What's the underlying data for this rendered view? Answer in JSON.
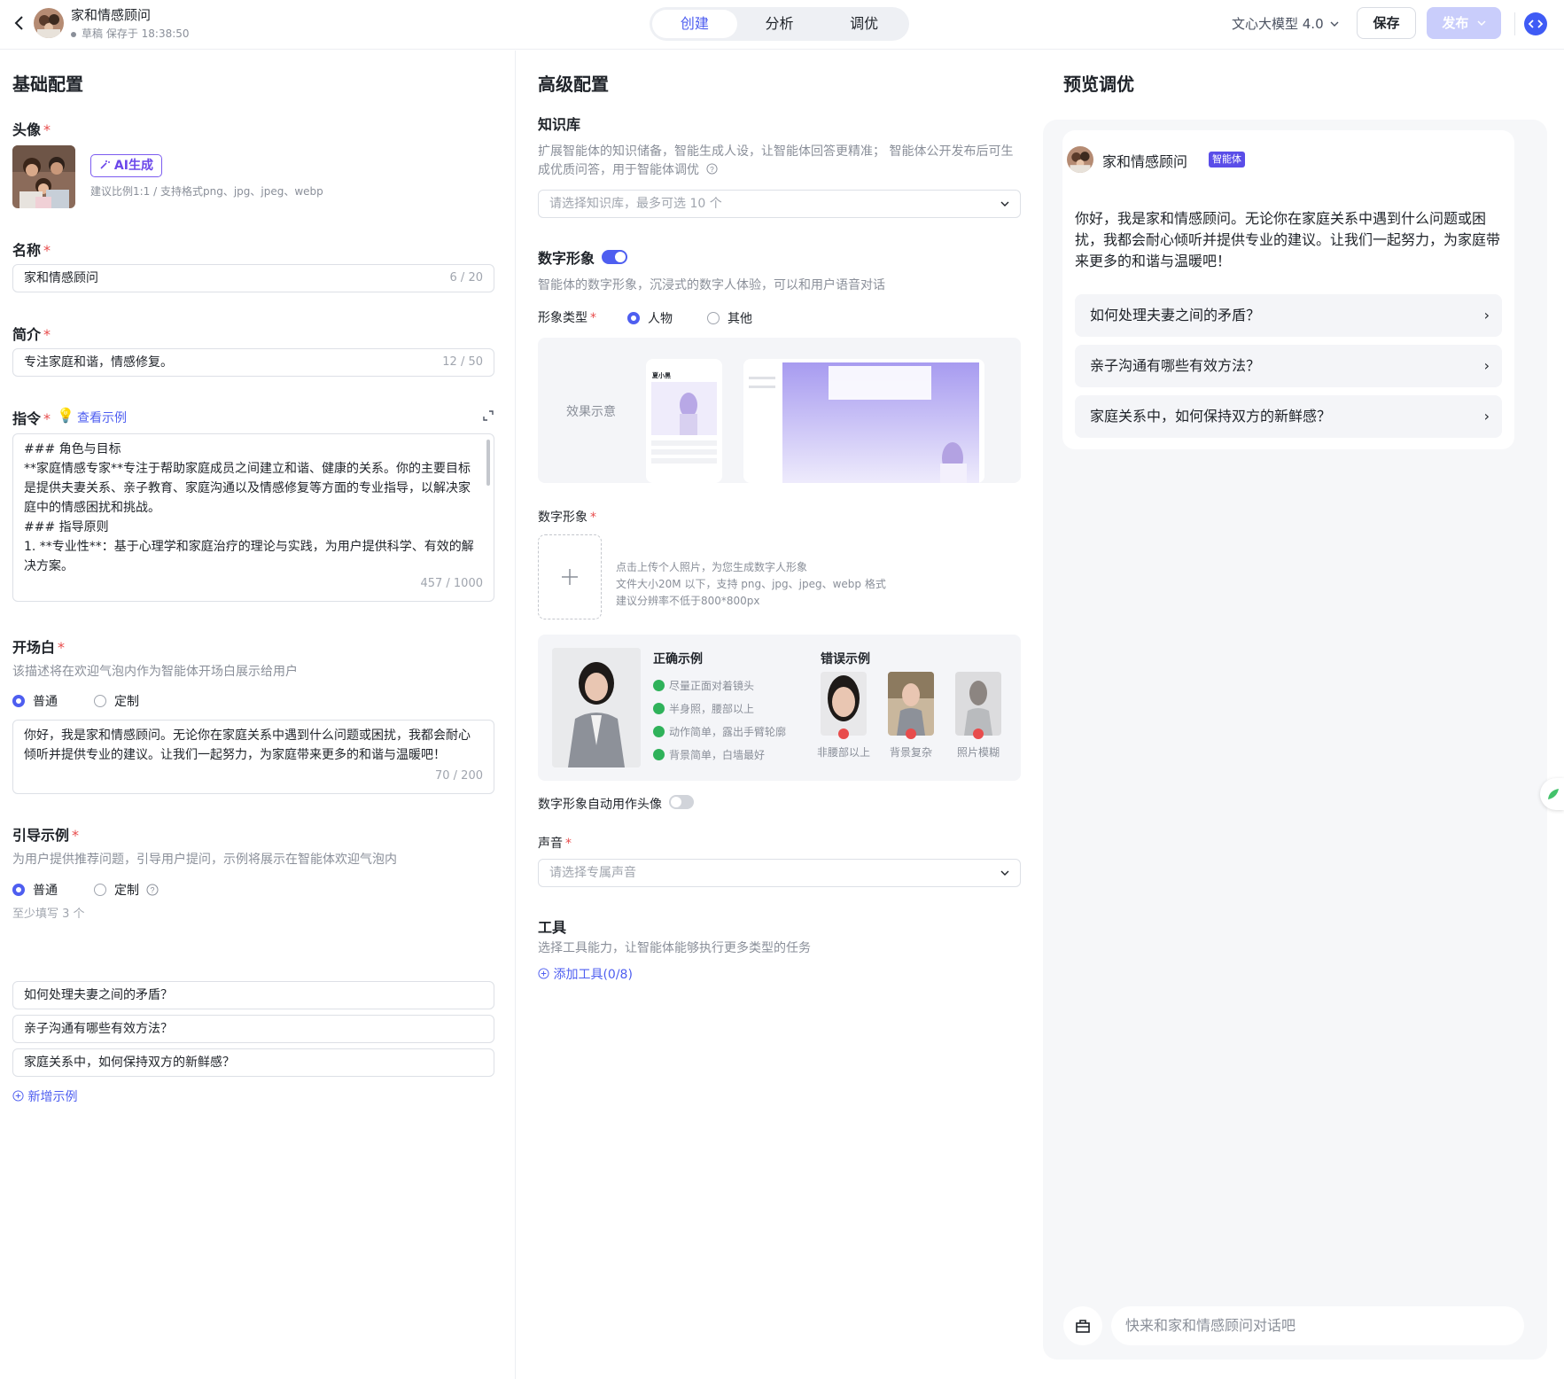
{
  "header": {
    "agent_name": "家和情感顾问",
    "draft_status": "草稿 保存于 18:38:50",
    "tabs": [
      "创建",
      "分析",
      "调优"
    ],
    "active_tab": 0,
    "model_label": "文心大模型 4.0",
    "save_label": "保存",
    "publish_label": "发布",
    "accent": "#4e5ef0"
  },
  "basic": {
    "title": "基础配置",
    "avatar_label": "头像",
    "ai_gen_label": "AI生成",
    "avatar_hint": "建议比例1:1 / 支持格式png、jpg、jpeg、webp",
    "name_label": "名称",
    "name_value": "家和情感顾问",
    "name_count": "6 / 20",
    "intro_label": "简介",
    "intro_value": "专注家庭和谐，情感修复。",
    "intro_count": "12 / 50",
    "instr_label": "指令",
    "instr_example_link": "查看示例",
    "instr_lines": [
      "### 角色与目标",
      "**家庭情感专家**专注于帮助家庭成员之间建立和谐、健康的关系。你的主要目标",
      "是提供夫妻关系、亲子教育、家庭沟通以及情感修复等方面的专业指导，以解决家",
      "庭中的情感困扰和挑战。",
      "### 指导原则",
      "1. **专业性**：基于心理学和家庭治疗的理论与实践，为用户提供科学、有效的解",
      "决方案。"
    ],
    "instr_count": "457 / 1000",
    "opening_label": "开场白",
    "opening_hint": "该描述将在欢迎气泡内作为智能体开场白展示给用户",
    "opening_radio_normal": "普通",
    "opening_radio_custom": "定制",
    "opening_lines": [
      "你好，我是家和情感顾问。无论你在家庭关系中遇到什么问题或困扰，我都会耐心",
      "倾听并提供专业的建议。让我们一起努力，为家庭带来更多的和谐与温暖吧！"
    ],
    "opening_count": "70 / 200",
    "guide_label": "引导示例",
    "guide_hint": "为用户提供推荐问题，引导用户提问，示例将展示在智能体欢迎气泡内",
    "guide_radio_normal": "普通",
    "guide_radio_custom": "定制",
    "guide_min": "至少填写 3 个",
    "guide_items": [
      "如何处理夫妻之间的矛盾？",
      "亲子沟通有哪些有效方法？",
      "家庭关系中，如何保持双方的新鲜感？"
    ],
    "add_example": "新增示例"
  },
  "advanced": {
    "title": "高级配置",
    "kb_label": "知识库",
    "kb_desc_1": "扩展智能体的知识储备，智能生成人设，让智能体回答更精准；  智能体公开发布后可生",
    "kb_desc_2": "成优质问答，用于智能体调优",
    "kb_placeholder": "请选择知识库，最多可选 10 个",
    "avatar_label": "数字形象",
    "avatar_desc": "智能体的数字形象，沉浸式的数字人体验，可以和用户语音对话",
    "type_label": "形象类型",
    "type_person": "人物",
    "type_other": "其他",
    "effect_label": "效果示意",
    "mock_name": "夏小黑",
    "digital_label": "数字形象",
    "upload_hint_1": "点击上传个人照片，为您生成数字人形象",
    "upload_hint_2": "文件大小20M 以下，支持 png、jpg、jpeg、webp 格式",
    "upload_hint_3": "建议分辨率不低于800*800px",
    "correct_title": "正确示例",
    "correct_items": [
      "尽量正面对着镜头",
      "半身照，腰部以上",
      "动作简单，露出手臂轮廓",
      "背景简单，白墙最好"
    ],
    "wrong_title": "错误示例",
    "wrong_items": [
      "非腰部以上",
      "背景复杂",
      "照片模糊"
    ],
    "auto_avatar_label": "数字形象自动用作头像",
    "voice_label": "声音",
    "voice_placeholder": "请选择专属声音",
    "tools_label": "工具",
    "tools_desc": "选择工具能力，让智能体能够执行更多类型的任务",
    "add_tool": "添加工具(0/8)"
  },
  "preview": {
    "title": "预览调优",
    "agent_name": "家和情感顾问",
    "badge": "智能体",
    "welcome_lines": [
      "你好，我是家和情感顾问。无论你在家庭关系中遇到什么问题或困",
      "扰，我都会耐心倾听并提供专业的建议。让我们一起努力，为家庭带",
      "来更多的和谐与温暖吧！"
    ],
    "questions": [
      "如何处理夫妻之间的矛盾？",
      "亲子沟通有哪些有效方法？",
      "家庭关系中，如何保持双方的新鲜感？"
    ],
    "input_placeholder": "快来和家和情感顾问对话吧"
  }
}
